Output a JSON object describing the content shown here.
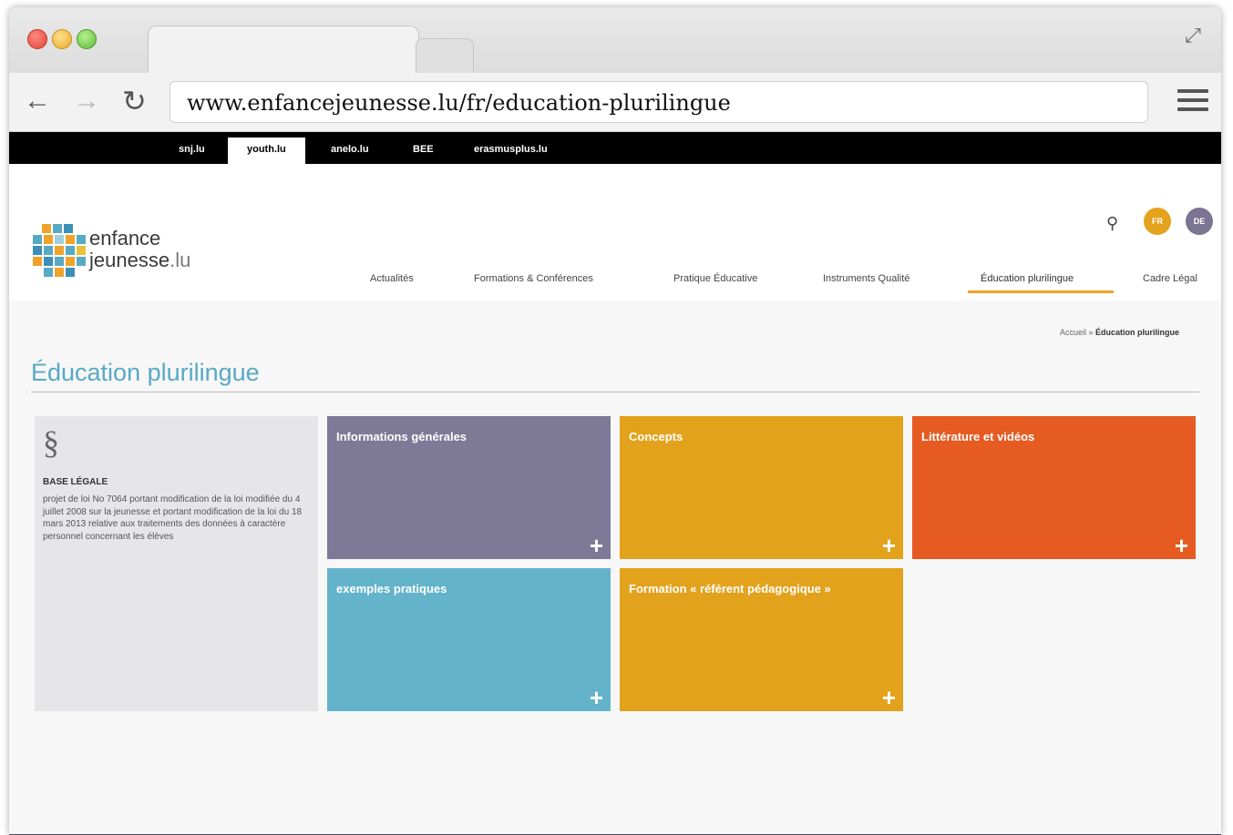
{
  "browser": {
    "url": "www.enfancejeunesse.lu/fr/education-plurilingue"
  },
  "topbar": {
    "links": [
      "snj.lu",
      "youth.lu",
      "anelo.lu",
      "BEE",
      "erasmusplus.lu"
    ],
    "active_index": 1
  },
  "logo": {
    "line1": "enfance",
    "line2": "jeunesse",
    "suffix": ".lu"
  },
  "languages": [
    "FR",
    "DE"
  ],
  "mainnav": [
    "Actualités",
    "Formations & Conférences",
    "Pratique Éducative",
    "Instruments Qualité",
    "Éducation plurilingue",
    "Cadre Légal"
  ],
  "breadcrumb": {
    "home": "Accueil",
    "sep": " » ",
    "current": "Éducation plurilingue"
  },
  "page": {
    "title": "Éducation plurilingue"
  },
  "legal": {
    "symbol": "§",
    "label": "BASE LÉGALE",
    "text": "projet de loi No 7064 portant modification de la loi modifiée du 4 juillet 2008 sur la jeunesse et portant modification de la loi du 18 mars 2013 relative aux traitements des données à caractère personnel concernant les élèves"
  },
  "tiles": [
    {
      "label": "Informations générales",
      "color": "#7d7996"
    },
    {
      "label": "Concepts",
      "color": "#e3a21c"
    },
    {
      "label": "Littérature et vidéos",
      "color": "#e55b22"
    },
    {
      "label": "exemples pratiques",
      "color": "#63b4cb"
    },
    {
      "label": "Formation « référent pédagogique »",
      "color": "#e3a21c"
    }
  ],
  "icons": {
    "plus": "+",
    "search": "search-icon",
    "back": "arrow-left-icon",
    "forward": "arrow-right-icon",
    "reload": "reload-icon",
    "menu": "hamburger-icon",
    "expand": "expand-icon"
  },
  "colors": {
    "accent_blue": "#58a9c4",
    "nav_underline": "#f0a32a",
    "lang_fr": "#e5a21c",
    "lang_de": "#7b7593"
  }
}
